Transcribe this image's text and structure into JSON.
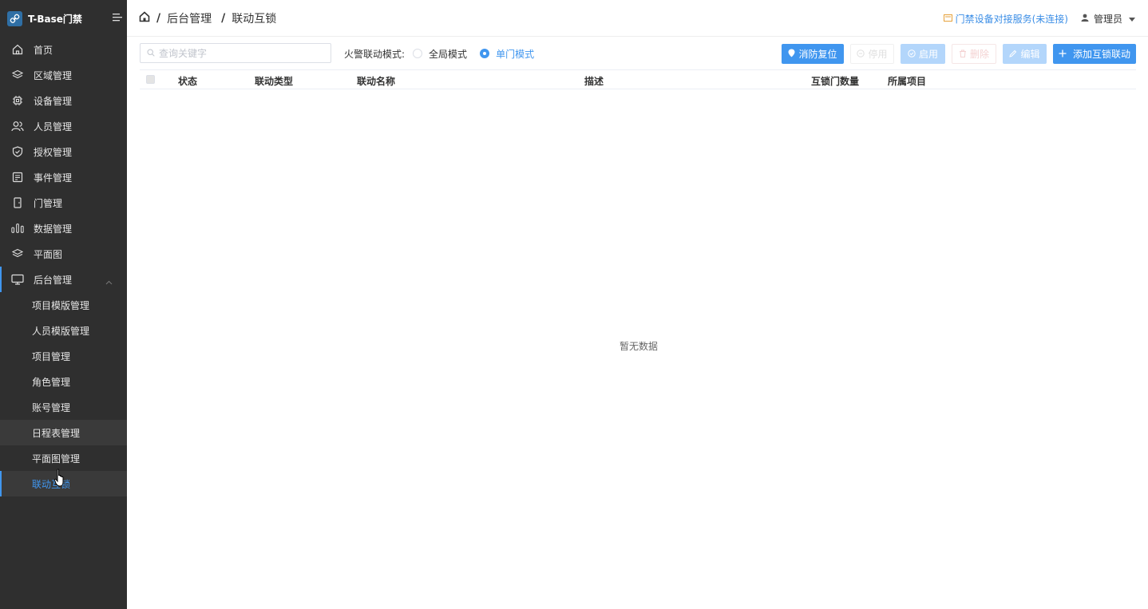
{
  "app": {
    "title": "T-Base门禁"
  },
  "sidebar": {
    "items": [
      {
        "label": "首页",
        "icon": "home-icon"
      },
      {
        "label": "区域管理",
        "icon": "layers-icon"
      },
      {
        "label": "设备管理",
        "icon": "chip-icon"
      },
      {
        "label": "人员管理",
        "icon": "users-icon"
      },
      {
        "label": "授权管理",
        "icon": "shield-icon"
      },
      {
        "label": "事件管理",
        "icon": "document-icon"
      },
      {
        "label": "门管理",
        "icon": "door-icon"
      },
      {
        "label": "数据管理",
        "icon": "bar-chart-icon"
      },
      {
        "label": "平面图",
        "icon": "layers-icon"
      },
      {
        "label": "后台管理",
        "icon": "monitor-icon"
      }
    ],
    "sub_items": [
      {
        "label": "项目模版管理"
      },
      {
        "label": "人员模版管理"
      },
      {
        "label": "项目管理"
      },
      {
        "label": "角色管理"
      },
      {
        "label": "账号管理"
      },
      {
        "label": "日程表管理"
      },
      {
        "label": "平面图管理"
      },
      {
        "label": "联动互锁"
      }
    ]
  },
  "header": {
    "breadcrumb": [
      "后台管理",
      "联动互锁"
    ],
    "service_status": "门禁设备对接服务(未连接)",
    "user": "管理员"
  },
  "toolbar": {
    "search_placeholder": "查询关键字",
    "fire_mode_label": "火警联动模式:",
    "mode_global": "全局模式",
    "mode_single": "单门模式",
    "btn_fire_reset": "消防复位",
    "btn_disable": "停用",
    "btn_enable": "启用",
    "btn_delete": "删除",
    "btn_edit": "编辑",
    "btn_add": "添加互锁联动"
  },
  "table": {
    "columns": [
      "状态",
      "联动类型",
      "联动名称",
      "描述",
      "互锁门数量",
      "所属项目"
    ],
    "empty_text": "暂无数据"
  },
  "colors": {
    "accent": "#4096ef",
    "sidebar_bg": "#2f2f2f"
  }
}
